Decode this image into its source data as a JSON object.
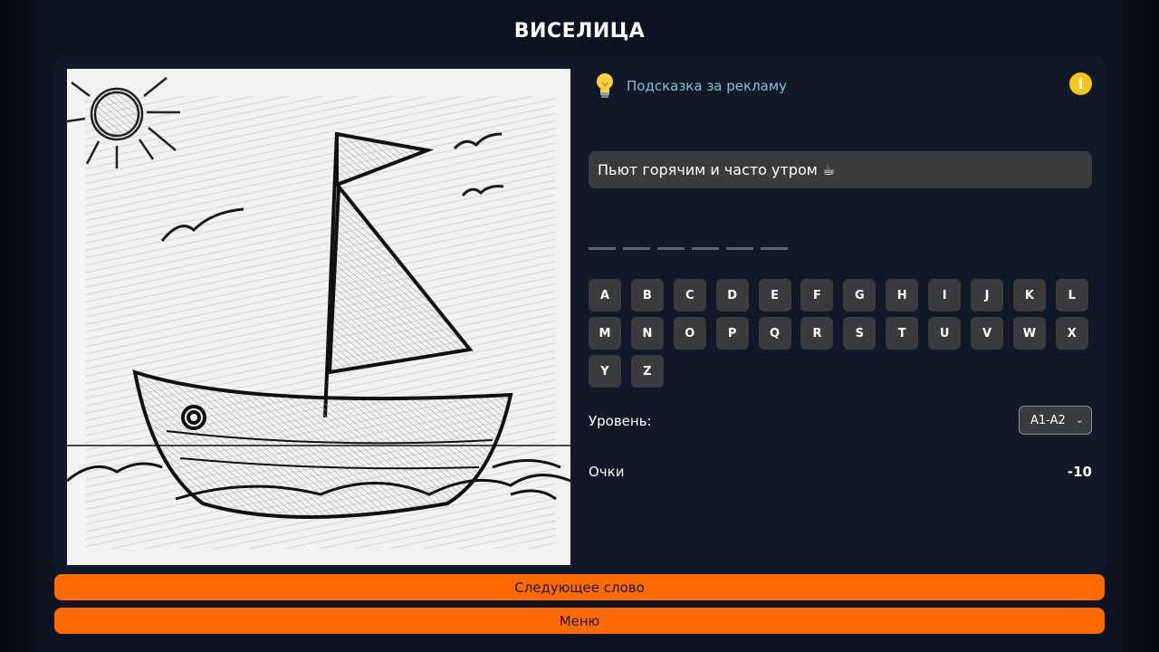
{
  "header": {
    "title": "ВИСЕЛИЦА"
  },
  "hint": {
    "label": "Подсказка за рекламу",
    "icon": "lightbulb-icon"
  },
  "info": {
    "icon": "info-icon",
    "glyph": "i"
  },
  "clue": {
    "text": "Пьют горячим и часто утром ☕"
  },
  "word": {
    "length": 6
  },
  "keyboard": {
    "letters": [
      "A",
      "B",
      "C",
      "D",
      "E",
      "F",
      "G",
      "H",
      "I",
      "J",
      "K",
      "L",
      "M",
      "N",
      "O",
      "P",
      "Q",
      "R",
      "S",
      "T",
      "U",
      "V",
      "W",
      "X",
      "Y",
      "Z"
    ]
  },
  "level": {
    "label": "Уровень:",
    "selected": "A1-A2"
  },
  "score": {
    "label": "Очки",
    "value": "-10"
  },
  "buttons": {
    "next": "Следующее слово",
    "menu": "Меню"
  },
  "colors": {
    "accent": "#ff6a00",
    "hint_text": "#7cc6d6",
    "info_icon": "#f5c518"
  }
}
